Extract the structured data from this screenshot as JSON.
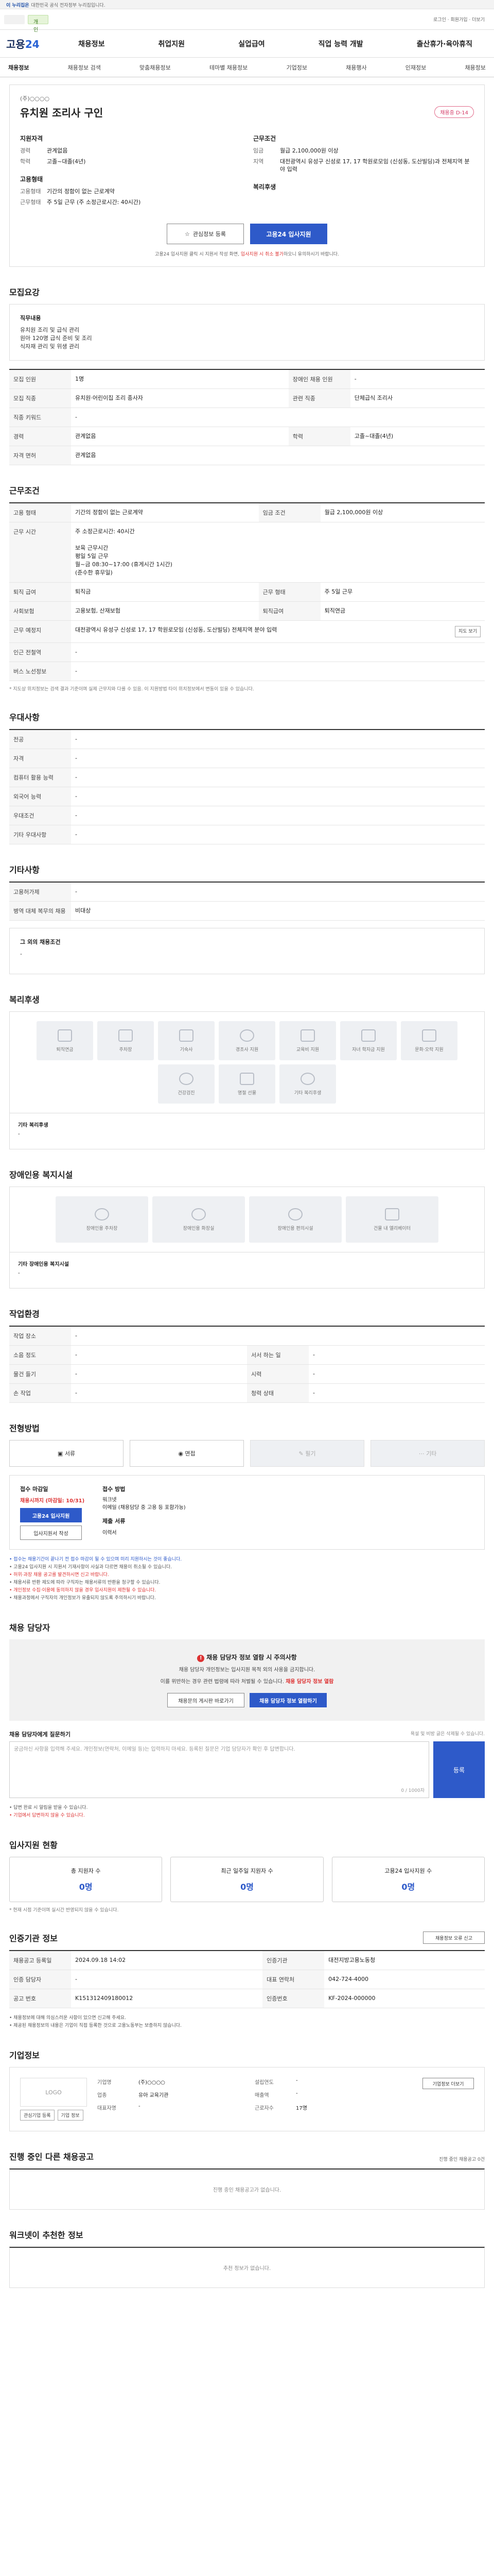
{
  "gov_banner": {
    "tag": "이 누리집은",
    "text": "대한민국 공식 전자정부 누리집입니다."
  },
  "topbar": {
    "active": "개인",
    "right": "로그인 · 회원가입 · 더보기"
  },
  "brand": {
    "logo_main": "고용",
    "logo_num": "24"
  },
  "gnb": [
    "채용정보",
    "취업지원",
    "실업급여",
    "직업 능력 개발",
    "출산휴가·육아휴직"
  ],
  "subnav": [
    "채용정보",
    "채용정보 검색",
    "맞춤채용정보",
    "테마별 채용정보",
    "기업정보",
    "채용행사",
    "인재정보",
    "채용정보"
  ],
  "job": {
    "company": "(주)○○○○",
    "title": "유치원 조리사 구인",
    "badge": "채용중 D-14",
    "qual_title": "지원자격",
    "qual": [
      {
        "k": "경력",
        "v": "관계없음"
      },
      {
        "k": "학력",
        "v": "고졸~대졸(4년)"
      }
    ],
    "form_title": "고용형태",
    "form": [
      {
        "k": "고용형태",
        "v": "기간의 정함이 없는 근로계약"
      },
      {
        "k": "근무형태",
        "v": "주 5일 근무 (주 소정근로시간: 40시간)"
      }
    ],
    "cond_title": "근무조건",
    "cond": [
      {
        "k": "임금",
        "v": "월급 2,100,000원 이상"
      },
      {
        "k": "지역",
        "v": "대전광역시 유성구 신성로 17, 17 학원로모임 (신성동, 도산빌딩)과 전체지역 분야 입력"
      }
    ],
    "benefit_title": "복리후생",
    "btn_save": "관심정보 등록",
    "btn_apply": "고용24 입사지원",
    "note_pre": "고용24 입사지원 클릭 시 지원서 작성 화면, ",
    "note_em": "입사지원 시 취소 불가",
    "note_post": "하오니 유의하시기 바랍니다."
  },
  "sections": {
    "recruit": "모집요강",
    "workcond": "근무조건",
    "pref": "우대사항",
    "other": "기타사항",
    "welfare": "복리후생",
    "disabled": "장애인용 복지시설",
    "biz_facility": "작업환경",
    "method": "전형방법",
    "manager": "채용 담당자",
    "apply_status": "입사지원 현황",
    "info": "인증기관 정보",
    "bizinfo": "기업정보",
    "other_jobs": "진행 중인 다른 채용공고",
    "recommend": "워크넷이 추천한 정보"
  },
  "recruit_box": {
    "title": "직무내용",
    "text": "유치원 조리 및 급식 관리\n원아 120명 급식 준비 및 조리\n식자재 관리 및 위생 관리"
  },
  "recruit_table": [
    [
      "모집 인원",
      "1명",
      "장애인 채용 인원",
      "-"
    ],
    [
      "모집 직종",
      "유치원·어린이집 조리 종사자",
      "관련 직종",
      "단체급식 조리사"
    ],
    [
      "직종 키워드",
      "-",
      "",
      ""
    ],
    [
      "경력",
      "관계없음",
      "학력",
      "고졸~대졸(4년)"
    ],
    [
      "자격 면허",
      "관계없음",
      "",
      ""
    ]
  ],
  "work_table": [
    [
      "고용 형태",
      "기간의 정함이 없는 근로계약",
      "임금 조건",
      "월급 2,100,000원 이상"
    ],
    [
      "근무 시간",
      "주 소정근로시간: 40시간\n\n보육 근무시간\n평일 5일 근무\n월~금 08:30~17:00 (휴게시간 1시간)\n(준수한 휴무일)",
      "",
      ""
    ],
    [
      "퇴직 급여",
      "퇴직금",
      "근무 형태",
      "주 5일 근무"
    ],
    [
      "사회보험",
      "고용보험, 산재보험",
      "퇴직급여",
      "퇴직연금"
    ],
    [
      "근무 예정지",
      "대전광역시 유성구 신성로 17, 17 학원로모임 (신성동, 도산빌딩) 전체지역 분야 입력",
      "",
      ""
    ],
    [
      "인근 전철역",
      "-",
      "",
      ""
    ],
    [
      "버스 노선정보",
      "-",
      "",
      ""
    ]
  ],
  "work_note": "* 지도상 위치정보는 검색 결과 기준이며 실제 근무지와 다를 수 있음. 이 지원방법 타이 위치정보에서 변동이 있을 수 있습니다.",
  "map_btn": "지도 보기",
  "pref_table": [
    [
      "전공",
      "-"
    ],
    [
      "자격",
      "-"
    ],
    [
      "컴퓨터 활용 능력",
      "-"
    ],
    [
      "외국어 능력",
      "-"
    ],
    [
      "우대조건",
      "-"
    ],
    [
      "기타 우대사항",
      "-"
    ]
  ],
  "other_table": [
    [
      "고용허가제",
      "-"
    ],
    [
      "병역 대체 복무의 채용",
      "비대상"
    ]
  ],
  "other_box": {
    "title": "그 외의 채용조건",
    "text": "-"
  },
  "welfare_icons": [
    "퇴직연금",
    "주차장",
    "기숙사",
    "경조사 지원",
    "교육비 지원",
    "자녀 학자금 지원",
    "문화·오락 지원",
    "건강검진",
    "명절 선물",
    "기타 복리후생"
  ],
  "welfare_etc": {
    "title": "기타 복리후생",
    "text": "-"
  },
  "disabled_icons": [
    "장애인용 주차장",
    "장애인용 화장실",
    "장애인용 편의시설",
    "건물 내 엘리베이터"
  ],
  "disabled_etc": {
    "title": "기타 장애인용 복지시설",
    "text": "-"
  },
  "env_table": [
    [
      "작업 장소",
      "-",
      "",
      ""
    ],
    [
      "소음 정도",
      "-",
      "서서 하는 일",
      "-"
    ],
    [
      "물건 들기",
      "-",
      "시력",
      "-"
    ],
    [
      "손 작업",
      "-",
      "청력 상태",
      "-"
    ]
  ],
  "method_tabs": [
    {
      "label": "서류",
      "on": true
    },
    {
      "label": "면접",
      "on": true
    },
    {
      "label": "필기",
      "on": false
    },
    {
      "label": "기타",
      "on": false
    }
  ],
  "apply": {
    "period_title": "접수 마감일",
    "period": "채용시까지 (마감일: 10/31)",
    "btn_apply": "고용24 입사지원",
    "btn_print": "입사지원서 작성",
    "way_title": "접수 방법",
    "ways": "워크넷\n이메일 (채용담당 중 고용 등 포함가능)",
    "docs_title": "제출 서류",
    "docs": "이력서"
  },
  "apply_bullets": [
    {
      "t": "접수는 채용기간이 끝나기 전 접수 마감이 될 수 있으며 미리 지원하시는 것이 좋습니다.",
      "c": "blue"
    },
    {
      "t": "고용24 입사지원 시 지원서 기재사항이 사실과 다르면 채용이 취소될 수 있습니다.",
      "c": ""
    },
    {
      "t": "허위·과장 채용 공고를 발견하시면 신고 바랍니다.",
      "c": "red"
    },
    {
      "t": "채용서류 반환 제도에 따라 구직자는 채용서류의 반환을 청구할 수 있습니다.",
      "c": ""
    },
    {
      "t": "개인정보 수집·이용에 동의하지 않을 경우 입사지원이 제한될 수 있습니다.",
      "c": "red"
    },
    {
      "t": "채용과정에서 구직자의 개인정보가 유출되지 않도록 주의하시기 바랍니다.",
      "c": ""
    }
  ],
  "manager": {
    "warn": "채용 담당자 정보 열람 시 주의사항",
    "p1": "채용 담당자 개인정보는 입사지원 목적 외의 사용을 금지합니다.",
    "p2": "이를 위반하는 경우 관련 법령에 따라 처벌될 수 있습니다.",
    "em": "채용 담당자 정보 열람",
    "btn_out": "채용문의 게시판 바로가기",
    "btn_in": "채용 담당자 정보 열람하기"
  },
  "qa": {
    "title": "채용 담당자에게 질문하기",
    "hint": "욕설 및 비방 글은 삭제될 수 있습니다.",
    "placeholder": "궁금하신 사항을 입력해 주세요. 개인정보(연락처, 이메일 등)는 입력하지 마세요. 등록된 질문은 기업 담당자가 확인 후 답변합니다.",
    "count": "0 / 1000자",
    "btn": "등록"
  },
  "qa_bullets": [
    "답변 완료 시 알림을 받을 수 있습니다.",
    "기업에서 답변하지 않을 수 있습니다."
  ],
  "stats": [
    {
      "label": "총 지원자 수",
      "n": "0명"
    },
    {
      "label": "최근 일주일 지원자 수",
      "n": "0명"
    },
    {
      "label": "고용24 입사지원 수",
      "n": "0명"
    }
  ],
  "stats_note": "* 현재 시점 기준이며 실시간 반영되지 않을 수 있습니다.",
  "info": {
    "btn": "채용정보 오류 신고",
    "rows": [
      [
        "채용공고 등록일",
        "2024.09.18 14:02",
        "인증기관",
        "대전지방고용노동청"
      ],
      [
        "인증 담당자",
        "-",
        "대표 연락처",
        "042-724-4000"
      ],
      [
        "공고 번호",
        "K151312409180012",
        "인증번호",
        "KF-2024-000000"
      ]
    ],
    "notes": [
      "채용정보에 대해 의심스러운 사항이 있으면 신고해 주세요.",
      "제공된 채용정보의 내용은 기업이 직접 등록한 것으로 고용노동부는 보증하지 않습니다."
    ]
  },
  "biz": {
    "logo": "LOGO",
    "logo_btns": [
      "관심기업 등록",
      "기업 정보"
    ],
    "more": "기업정보 더보기",
    "rows": [
      [
        "기업명",
        "(주)○○○○",
        "설립연도",
        "-"
      ],
      [
        "업종",
        "유아 교육기관",
        "매출액",
        "-"
      ],
      [
        "대표자명",
        "-",
        "근로자수",
        "17명"
      ]
    ]
  },
  "other_jobs_right": "진행 중인 채용공고 0건",
  "other_jobs_empty": "진행 중인 채용공고가 없습니다.",
  "recommend_empty": "추천 정보가 없습니다."
}
